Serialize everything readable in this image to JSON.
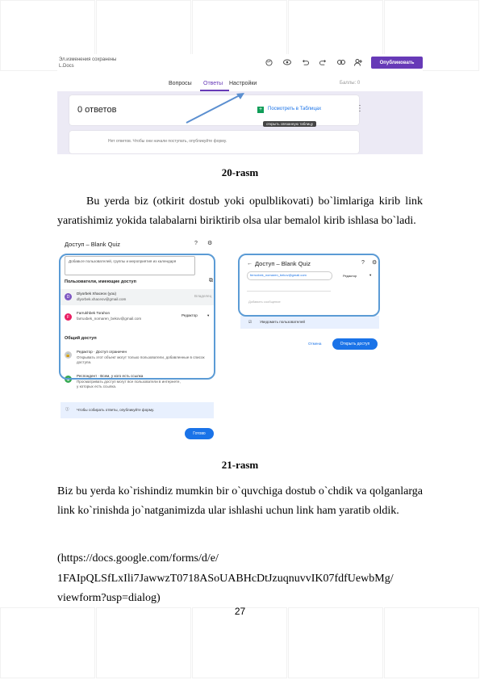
{
  "figure1": {
    "doc_title": "Эл.изменения сохранены",
    "doc_subtitle": "L.Docs",
    "icons": [
      "palette-icon",
      "eye-icon",
      "undo-icon",
      "redo-icon",
      "link-icon",
      "add-person-icon"
    ],
    "publish_label": "Опубликовать",
    "tabs": [
      {
        "label": "Вопросы",
        "active": false
      },
      {
        "label": "Ответы",
        "active": true
      },
      {
        "label": "Настройки",
        "active": false
      }
    ],
    "right_hint": "Баллы: 0",
    "response_count": "0 ответов",
    "sheets_link": "Посмотреть в Таблицах",
    "tooltip": "открыть связанную таблицу",
    "card2_text": "Нет ответов. Чтобы они начали поступать, опубликуйте форму.",
    "accent_color": "#673ab7"
  },
  "caption1": "20-rasm",
  "paragraph1": "Bu yerda biz (otkirit dostub yoki opulblikovati) bo`limlariga kirib link yaratishimiz yokida talabalarni biriktirib olsa ular bemalol kirib ishlasa bo`ladi.",
  "figure2": {
    "left_dialog": {
      "title": "Доступ – Blank Quiz",
      "add_placeholder": "Добавьте пользователей, группы и мероприятия из календаря",
      "people_header": "Пользователи, имеющие доступ",
      "people": [
        {
          "initial": "D",
          "color": "#7e57c2",
          "name": "Dlyorbek Xhaceov (you)",
          "email": "dlyorbek.xhaceov@gmail.com",
          "role": "Владелец"
        },
        {
          "initial": "F",
          "color": "#e91e63",
          "name": "Farrukhbek Torahon",
          "email": "farruxbek_nomaren_bekov@gmail.com",
          "role": "Редактор"
        }
      ],
      "general_header": "Общий доступ",
      "general": [
        {
          "title": "Редактор · Доступ ограничен",
          "desc": "Открывать этот объект могут только пользователи, добавленные в список доступа."
        },
        {
          "title": "Респондент · Всем, у кого есть ссылка",
          "desc": "Просматривать доступ могут все пользователи в интернете, у которых есть ссылка."
        }
      ],
      "info_text": "Чтобы собирать ответы, опубликуйте форму.",
      "done_label": "Готово"
    },
    "right_dialog": {
      "title": "Доступ – Blank Quiz",
      "chip": "ferruxbek_nomaren_bekov@gmail.com",
      "role": "Редактор",
      "message_placeholder": "Добавить сообщение",
      "notify_label": "Уведомить пользователей",
      "cancel_label": "Отмена",
      "send_label": "Открыть доступ"
    }
  },
  "caption2": "21-rasm",
  "paragraph2": "Biz bu yerda ko`rishindiz mumkin bir o`quvchiga dostub o`chdik va qolganlarga link ko`rinishda jo`natganimizda ular ishlashi uchun link ham yaratib oldik.",
  "link_lines": [
    "(https://docs.google.com/forms/d/e/",
    "1FAIpQLSfLxIli7JawwzT0718ASoUABHcDtJzuqnuvvIK07fdfUewbMg/",
    "viewform?usp=dialog)"
  ],
  "page_number": "27"
}
